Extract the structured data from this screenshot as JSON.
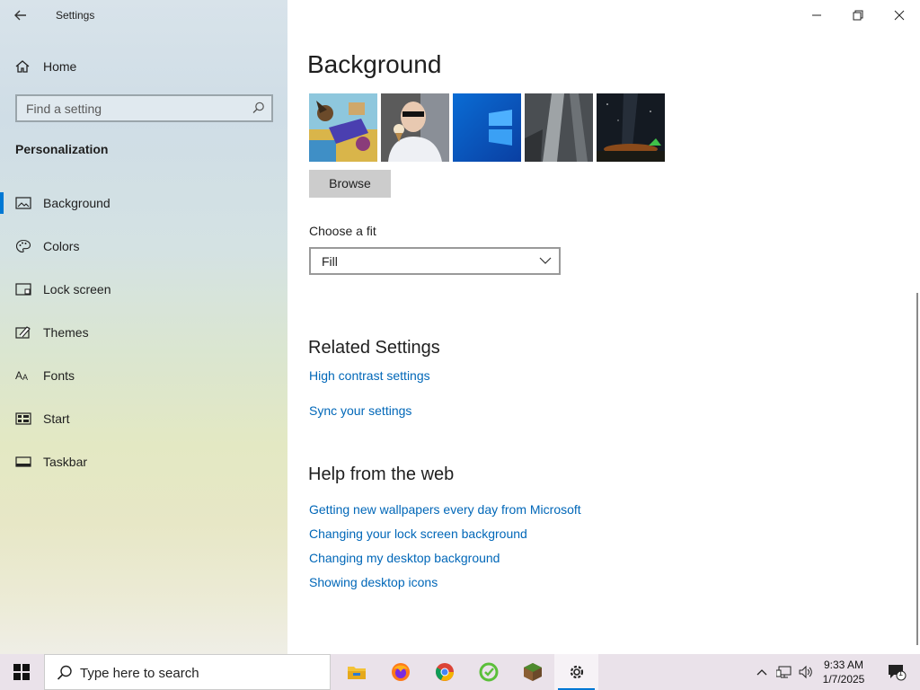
{
  "window": {
    "title": "Settings",
    "controls": {
      "minimize": "minimize-icon",
      "restore": "restore-icon",
      "close": "close-icon"
    }
  },
  "sidebar": {
    "home_label": "Home",
    "search_placeholder": "Find a setting",
    "section_title": "Personalization",
    "items": [
      {
        "label": "Background",
        "icon": "picture-icon",
        "active": true
      },
      {
        "label": "Colors",
        "icon": "palette-icon",
        "active": false
      },
      {
        "label": "Lock screen",
        "icon": "lock-screen-icon",
        "active": false
      },
      {
        "label": "Themes",
        "icon": "themes-icon",
        "active": false
      },
      {
        "label": "Fonts",
        "icon": "fonts-icon",
        "active": false
      },
      {
        "label": "Start",
        "icon": "start-icon",
        "active": false
      },
      {
        "label": "Taskbar",
        "icon": "taskbar-icon",
        "active": false
      }
    ]
  },
  "main": {
    "heading": "Background",
    "browse_label": "Browse",
    "fit_label": "Choose a fit",
    "fit_value": "Fill",
    "related_heading": "Related Settings",
    "related_links": [
      "High contrast settings",
      "Sync your settings"
    ],
    "help_heading": "Help from the web",
    "help_links": [
      "Getting new wallpapers every day from Microsoft",
      "Changing your lock screen background",
      "Changing my desktop background",
      "Showing desktop icons"
    ]
  },
  "taskbar": {
    "search_placeholder": "Type here to search",
    "time": "9:33 AM",
    "date": "1/7/2025",
    "notification_count": "1"
  },
  "colors": {
    "accent": "#0078d4",
    "link": "#0067b8"
  }
}
